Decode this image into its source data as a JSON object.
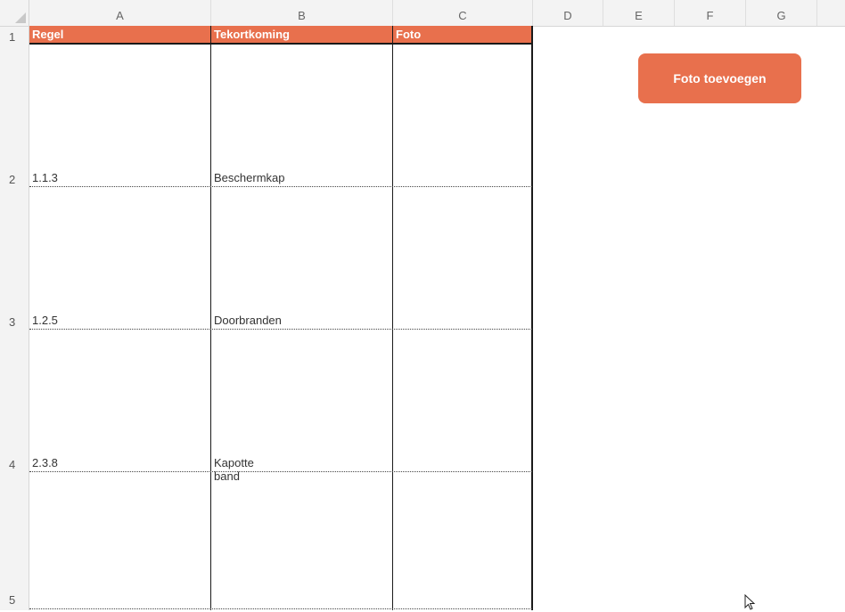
{
  "columns": [
    "A",
    "B",
    "C",
    "D",
    "E",
    "F",
    "G"
  ],
  "rows": [
    "1",
    "2",
    "3",
    "4",
    "5"
  ],
  "table": {
    "headers": [
      "Regel",
      "Tekortkoming",
      "Foto"
    ],
    "records": [
      {
        "regel": "1.1.3",
        "tekortkoming": "Beschermkap",
        "foto": ""
      },
      {
        "regel": "1.2.5",
        "tekortkoming": "Doorbranden",
        "foto": ""
      },
      {
        "regel": "2.3.8",
        "tekortkoming": "Kapotte band",
        "foto": ""
      },
      {
        "regel": "",
        "tekortkoming": "",
        "foto": ""
      }
    ]
  },
  "button": {
    "label": "Foto toevoegen"
  },
  "colors": {
    "accent": "#e8704d",
    "grid_line": "#1a1a1a",
    "header_bg": "#f3f3f3"
  },
  "icons": {
    "cursor": "arrow-cursor-icon"
  }
}
